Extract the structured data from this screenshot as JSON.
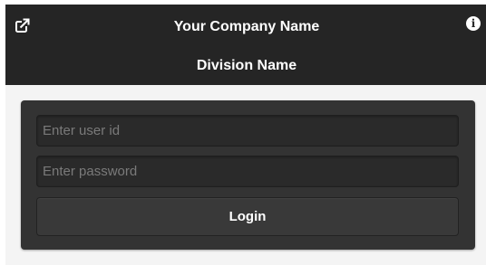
{
  "header": {
    "title": "Your Company Name",
    "subtitle": "Division Name",
    "left_icon": "share-icon",
    "right_icon": "info-icon",
    "info_glyph": "i"
  },
  "login_form": {
    "user_id_placeholder": "Enter user id",
    "user_id_value": "",
    "password_placeholder": "Enter password",
    "password_value": "",
    "login_label": "Login"
  },
  "colors": {
    "header_bg": "#252525",
    "panel_bg": "#333333",
    "page_bg": "#f4f4f4"
  }
}
